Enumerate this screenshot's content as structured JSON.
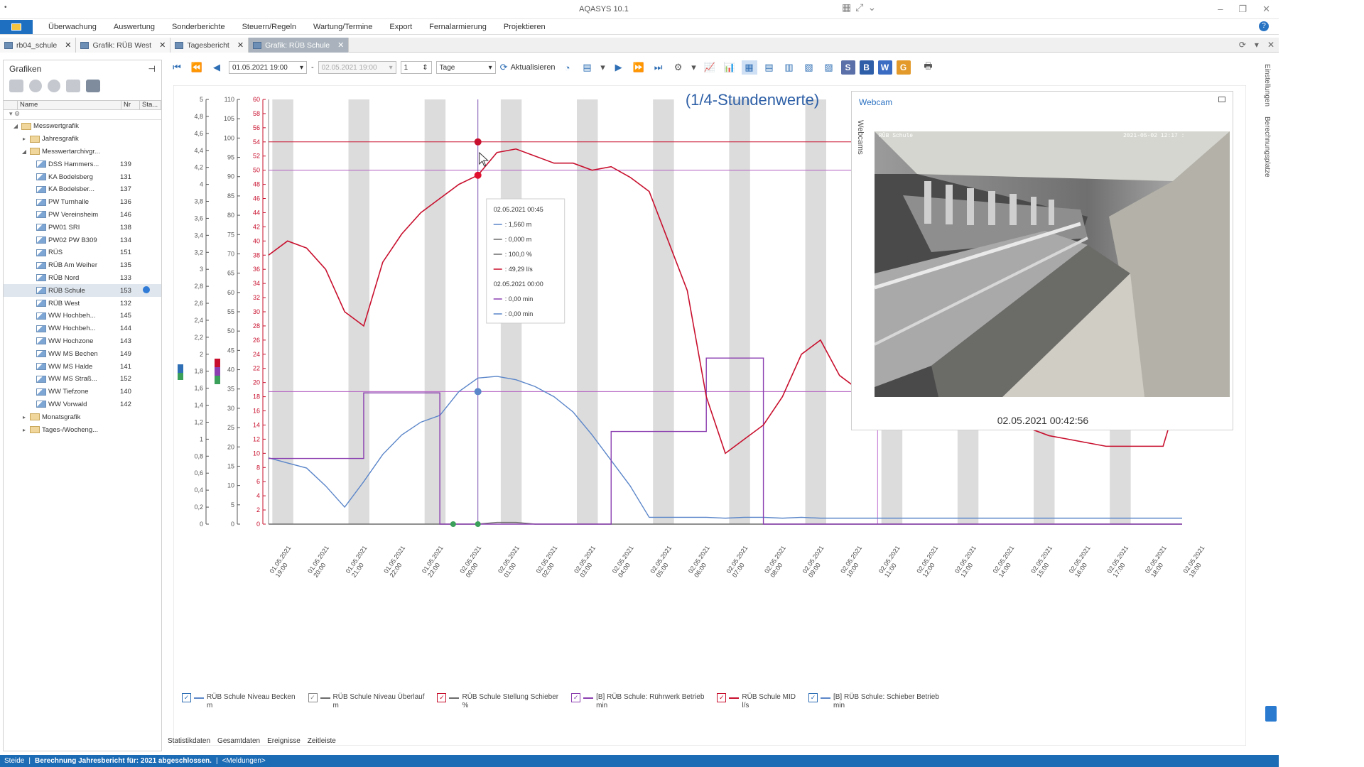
{
  "window": {
    "title": "AQASYS 10.1"
  },
  "menu": [
    "Überwachung",
    "Auswertung",
    "Sonderberichte",
    "Steuern/Regeln",
    "Wartung/Termine",
    "Export",
    "Fernalarmierung",
    "Projektieren"
  ],
  "tabs": [
    {
      "label": "rb04_schule",
      "active": false
    },
    {
      "label": "Grafik: RÜB West",
      "active": false
    },
    {
      "label": "Tagesbericht",
      "active": false
    },
    {
      "label": "Grafik: RÜB Schule",
      "active": true
    }
  ],
  "left_panel": {
    "title": "Grafiken",
    "columns": {
      "name": "Name",
      "nr": "Nr",
      "status": "Sta..."
    },
    "tree": [
      {
        "label": "Messwertgrafik",
        "nr": "",
        "level": 1,
        "kind": "folder",
        "expanded": true
      },
      {
        "label": "Jahresgrafik",
        "nr": "",
        "level": 2,
        "kind": "folder",
        "expanded": false
      },
      {
        "label": "Messwertarchivgr...",
        "nr": "",
        "level": 2,
        "kind": "folder",
        "expanded": true
      },
      {
        "label": "DSS Hammers...",
        "nr": "139",
        "level": 3,
        "kind": "chart"
      },
      {
        "label": "KA Bodelsberg",
        "nr": "131",
        "level": 3,
        "kind": "chart"
      },
      {
        "label": "KA Bodelsber...",
        "nr": "137",
        "level": 3,
        "kind": "chart"
      },
      {
        "label": "PW Turnhalle",
        "nr": "136",
        "level": 3,
        "kind": "chart"
      },
      {
        "label": "PW Vereinsheim",
        "nr": "146",
        "level": 3,
        "kind": "chart"
      },
      {
        "label": "PW01 SRI",
        "nr": "138",
        "level": 3,
        "kind": "chart"
      },
      {
        "label": "PW02 PW B309",
        "nr": "134",
        "level": 3,
        "kind": "chart"
      },
      {
        "label": "RÜS",
        "nr": "151",
        "level": 3,
        "kind": "chart"
      },
      {
        "label": "RÜB Am Weiher",
        "nr": "135",
        "level": 3,
        "kind": "chart"
      },
      {
        "label": "RÜB Nord",
        "nr": "133",
        "level": 3,
        "kind": "chart"
      },
      {
        "label": "RÜB Schule",
        "nr": "153",
        "level": 3,
        "kind": "chart",
        "selected": true
      },
      {
        "label": "RÜB West",
        "nr": "132",
        "level": 3,
        "kind": "chart"
      },
      {
        "label": "WW Hochbeh...",
        "nr": "145",
        "level": 3,
        "kind": "chart"
      },
      {
        "label": "WW Hochbeh...",
        "nr": "144",
        "level": 3,
        "kind": "chart"
      },
      {
        "label": "WW Hochzone",
        "nr": "143",
        "level": 3,
        "kind": "chart"
      },
      {
        "label": "WW MS Bechen",
        "nr": "149",
        "level": 3,
        "kind": "chart"
      },
      {
        "label": "WW MS Halde",
        "nr": "141",
        "level": 3,
        "kind": "chart"
      },
      {
        "label": "WW MS Straß...",
        "nr": "152",
        "level": 3,
        "kind": "chart"
      },
      {
        "label": "WW Tiefzone",
        "nr": "140",
        "level": 3,
        "kind": "chart"
      },
      {
        "label": "WW Vorwald",
        "nr": "142",
        "level": 3,
        "kind": "chart"
      },
      {
        "label": "Monatsgrafik",
        "nr": "",
        "level": 2,
        "kind": "folder",
        "expanded": false
      },
      {
        "label": "Tages-/Wocheng...",
        "nr": "",
        "level": 2,
        "kind": "folder",
        "expanded": false
      }
    ]
  },
  "toolbar": {
    "date_from": "01.05.2021 19:00",
    "date_to": "02.05.2021 19:00",
    "step": "1",
    "unit": "Tage",
    "refresh_label": "Aktualisieren",
    "letter_buttons": [
      "S",
      "B",
      "W",
      "G"
    ]
  },
  "chart_data": {
    "type": "line",
    "title": "(1/4-Stundenwerte)",
    "x": [
      "01.05.2021 19:00",
      "01.05.2021 20:00",
      "01.05.2021 21:00",
      "01.05.2021 22:00",
      "01.05.2021 23:00",
      "02.05.2021 00:00",
      "02.05.2021 01:00",
      "02.05.2021 02:00",
      "02.05.2021 03:00",
      "02.05.2021 04:00",
      "02.05.2021 05:00",
      "02.05.2021 06:00",
      "02.05.2021 07:00",
      "02.05.2021 08:00",
      "02.05.2021 09:00",
      "02.05.2021 10:00",
      "02.05.2021 11:00",
      "02.05.2021 12:00",
      "02.05.2021 13:00",
      "02.05.2021 14:00",
      "02.05.2021 15:00",
      "02.05.2021 16:00",
      "02.05.2021 17:00",
      "02.05.2021 18:00",
      "02.05.2021 19:00"
    ],
    "axes": [
      {
        "ticks": [
          "0",
          "0,2",
          "0,4",
          "0,6",
          "0,8",
          "1",
          "1,2",
          "1,4",
          "1,6",
          "1,8",
          "2",
          "2,2",
          "2,4",
          "2,6",
          "2,8",
          "3",
          "3,2",
          "3,4",
          "3,6",
          "3,8",
          "4",
          "4,2",
          "4,4",
          "4,6",
          "4,8",
          "5"
        ],
        "color": "#555555"
      },
      {
        "ticks": [
          "0",
          "5",
          "10",
          "15",
          "20",
          "25",
          "30",
          "35",
          "40",
          "45",
          "50",
          "55",
          "60",
          "65",
          "70",
          "75",
          "80",
          "85",
          "90",
          "95",
          "100",
          "105",
          "110"
        ],
        "color": "#555555"
      },
      {
        "ticks": [
          "0",
          "2",
          "4",
          "6",
          "8",
          "10",
          "12",
          "14",
          "16",
          "18",
          "20",
          "22",
          "24",
          "26",
          "28",
          "30",
          "32",
          "34",
          "36",
          "38",
          "40",
          "42",
          "44",
          "46",
          "48",
          "50",
          "52",
          "54",
          "56",
          "58",
          "60"
        ],
        "color": "#c8102e"
      }
    ],
    "series": [
      {
        "name": "RÜB Schule Niveau Becken",
        "unit": "m",
        "color": "#5b86c9",
        "axis": 0,
        "step": false,
        "values": [
          0.78,
          0.72,
          0.66,
          0.45,
          0.2,
          0.5,
          0.82,
          1.05,
          1.2,
          1.28,
          1.56,
          1.72,
          1.74,
          1.7,
          1.62,
          1.5,
          1.32,
          1.05,
          0.75,
          0.45,
          0.08,
          0.08,
          0.08,
          0.08,
          0.07,
          0.08,
          0.08,
          0.07,
          0.08,
          0.07,
          0.07,
          0.07,
          0.07,
          0.07,
          0.07,
          0.07,
          0.07,
          0.07,
          0.07,
          0.07,
          0.07,
          0.07,
          0.07,
          0.07,
          0.07,
          0.07,
          0.07,
          0.07,
          0.07
        ]
      },
      {
        "name": "RÜB Schule Niveau Überlauf",
        "unit": "m",
        "color": "#6c6c6c",
        "axis": 0,
        "step": false,
        "values": [
          0,
          0,
          0,
          0,
          0,
          0,
          0,
          0,
          0,
          0,
          0,
          0,
          0.02,
          0.02,
          0,
          0,
          0,
          0,
          0,
          0,
          0,
          0,
          0,
          0,
          0,
          0,
          0,
          0,
          0,
          0,
          0,
          0,
          0,
          0,
          0,
          0,
          0,
          0,
          0,
          0,
          0,
          0,
          0,
          0,
          0,
          0,
          0,
          0,
          0
        ]
      },
      {
        "name": "RÜB Schule Stellung Schieber",
        "unit": "%",
        "color": "#6c6c6c",
        "axis": 1,
        "step": false,
        "values": []
      },
      {
        "name": "[B] RÜB Schule: Rührwerk Betrieb",
        "unit": "min",
        "color": "#8b3fb0",
        "axis": 1,
        "step": true,
        "values": [
          17,
          17,
          17,
          17,
          17,
          34,
          34,
          34,
          34,
          0,
          0,
          0,
          0,
          0,
          0,
          0,
          0,
          0,
          24,
          24,
          24,
          24,
          24,
          43,
          43,
          43,
          0,
          0,
          0,
          0,
          0,
          0,
          0,
          0,
          0,
          0,
          0,
          0,
          0,
          0,
          0,
          0,
          0,
          0,
          0,
          0,
          0,
          0,
          0
        ]
      },
      {
        "name": "RÜB Schule MID",
        "unit": "l/s",
        "color": "#c8102e",
        "axis": 2,
        "step": false,
        "values": [
          38,
          40,
          39,
          36,
          30,
          28,
          37,
          41,
          44,
          46,
          48,
          49.29,
          52.5,
          53,
          52,
          51,
          51,
          50,
          50.5,
          49,
          47,
          40,
          33,
          18,
          10,
          12,
          14,
          18,
          24,
          26,
          21,
          19,
          28,
          25,
          40,
          28,
          23,
          21,
          16,
          14,
          13.5,
          12.5,
          12,
          11.5,
          11,
          11,
          11,
          11,
          20
        ]
      },
      {
        "name": "[B] RÜB Schule: Schieber Betrieb",
        "unit": "min",
        "color": "#5b86c9",
        "axis": 1,
        "step": true,
        "values": []
      }
    ],
    "ylim_left": [
      0,
      5
    ],
    "ylim_mid": [
      0,
      110
    ],
    "ylim_right": [
      0,
      60
    ],
    "grid": true,
    "legend": "bottom",
    "reference_lines": [
      {
        "axis": 2,
        "value": 54,
        "color": "#c8102e"
      },
      {
        "axis": 2,
        "value": 50,
        "color": "#b05cc0"
      },
      {
        "axis": 0,
        "value": 1.56,
        "color": "#b05cc0"
      }
    ],
    "tooltip": {
      "time": "02.05.2021 00:45",
      "rows": [
        ": 1,560 m",
        ": 0,000 m",
        ": 100,0 %",
        ": 49,29 l/s"
      ],
      "time2": "02.05.2021 00:00",
      "rows2": [
        ": 0,00 min",
        ": 0,00 min"
      ]
    }
  },
  "webcam": {
    "title": "Webcam",
    "side_label": "Webcams",
    "overlay_left": "RÜB Schule",
    "overlay_right": "2021-05-02 12:17 :",
    "timestamp": "02.05.2021 00:42:56"
  },
  "right_strip": [
    "Einstellungen",
    "Berechnungsplatze"
  ],
  "legend": [
    {
      "name": "RÜB Schule Niveau Becken",
      "unit": "m",
      "color": "#5b86c9",
      "checked": true,
      "cbcolor": "#2f6fb5",
      "step": false
    },
    {
      "name": "RÜB Schule Niveau Überlauf",
      "unit": "m",
      "color": "#6c6c6c",
      "checked": true,
      "cbcolor": "#8a8a8a",
      "step": false
    },
    {
      "name": "RÜB Schule Stellung Schieber",
      "unit": "%",
      "color": "#6c6c6c",
      "checked": true,
      "cbcolor": "#c8102e",
      "step": false
    },
    {
      "name": "[B] RÜB Schule: Rührwerk Betrieb",
      "unit": "min",
      "color": "#8b3fb0",
      "checked": true,
      "cbcolor": "#8b3fb0",
      "step": true
    },
    {
      "name": "RÜB Schule MID",
      "unit": "l/s",
      "color": "#c8102e",
      "checked": true,
      "cbcolor": "#c8102e",
      "step": false
    },
    {
      "name": "[B] RÜB Schule: Schieber Betrieb",
      "unit": "min",
      "color": "#5b86c9",
      "checked": true,
      "cbcolor": "#2f6fb5",
      "step": true
    }
  ],
  "bottom_tabs": [
    "Statistikdaten",
    "Gesamtdaten",
    "Ereignisse",
    "Zeitleiste"
  ],
  "status": {
    "left": "Steide",
    "message": "Berechnung Jahresbericht für: 2021 abgeschlossen.",
    "msgs": "<Meldungen>"
  }
}
